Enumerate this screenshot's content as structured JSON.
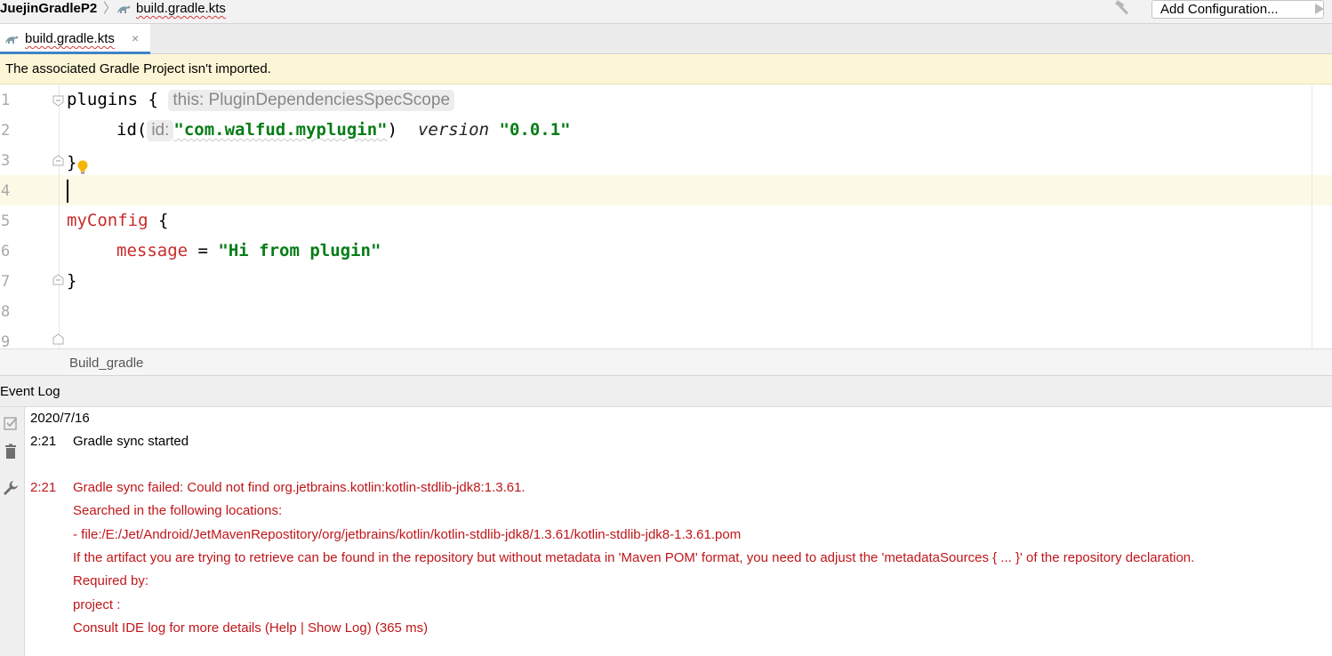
{
  "navbar": {
    "project": "JuejinGradleP2",
    "file": "build.gradle.kts",
    "add_configuration": "Add Configuration..."
  },
  "tab": {
    "label": "build.gradle.kts",
    "close": "×"
  },
  "banner": {
    "message": "The associated Gradle Project isn't imported."
  },
  "editor": {
    "line_numbers": [
      "1",
      "2",
      "3",
      "4",
      "5",
      "6",
      "7",
      "8",
      "9"
    ],
    "plugins_kw": "plugins {",
    "plugins_hint": "this: PluginDependenciesSpecScope",
    "id_call": "id(",
    "id_hint": "id:",
    "id_value": "\"com.walfud.myplugin\"",
    "id_close": ")",
    "version_kw": "version",
    "version_value": "\"0.0.1\"",
    "close_brace": "}",
    "myconfig_kw": "myConfig",
    "myconfig_brace": " {",
    "message_kw": "message",
    "equals": " = ",
    "message_value": "\"Hi from plugin\""
  },
  "breadcrumb": {
    "text": "Build_gradle"
  },
  "event_log": {
    "title": "Event Log",
    "date": "2020/7/16",
    "entries": [
      {
        "time": "2:21",
        "text": "Gradle sync started"
      },
      {
        "time": "2:21",
        "text": "Gradle sync failed: Could not find org.jetbrains.kotlin:kotlin-stdlib-jdk8:1.3.61."
      }
    ],
    "details": [
      "Searched in the following locations:",
      "- file:/E:/Jet/Android/JetMavenRepostitory/org/jetbrains/kotlin/kotlin-stdlib-jdk8/1.3.61/kotlin-stdlib-jdk8-1.3.61.pom",
      "If the artifact you are trying to retrieve can be found in the repository but without metadata in 'Maven POM' format, you need to adjust the 'metadataSources { ... }' of the repository declaration.",
      "Required by:",
      "project :",
      "Consult IDE log for more details (Help | Show Log) (365 ms)"
    ]
  },
  "colors": {
    "error": "#c0161a",
    "string": "#067d17",
    "keyword_red": "#c92a2a",
    "banner_bg": "#fdf6d6",
    "tab_accent": "#4083c9"
  },
  "icons": [
    "gradle-file-icon",
    "hammer-icon",
    "run-icon",
    "fold-icon",
    "lightbulb-icon",
    "check-icon",
    "trash-icon",
    "wrench-icon"
  ]
}
